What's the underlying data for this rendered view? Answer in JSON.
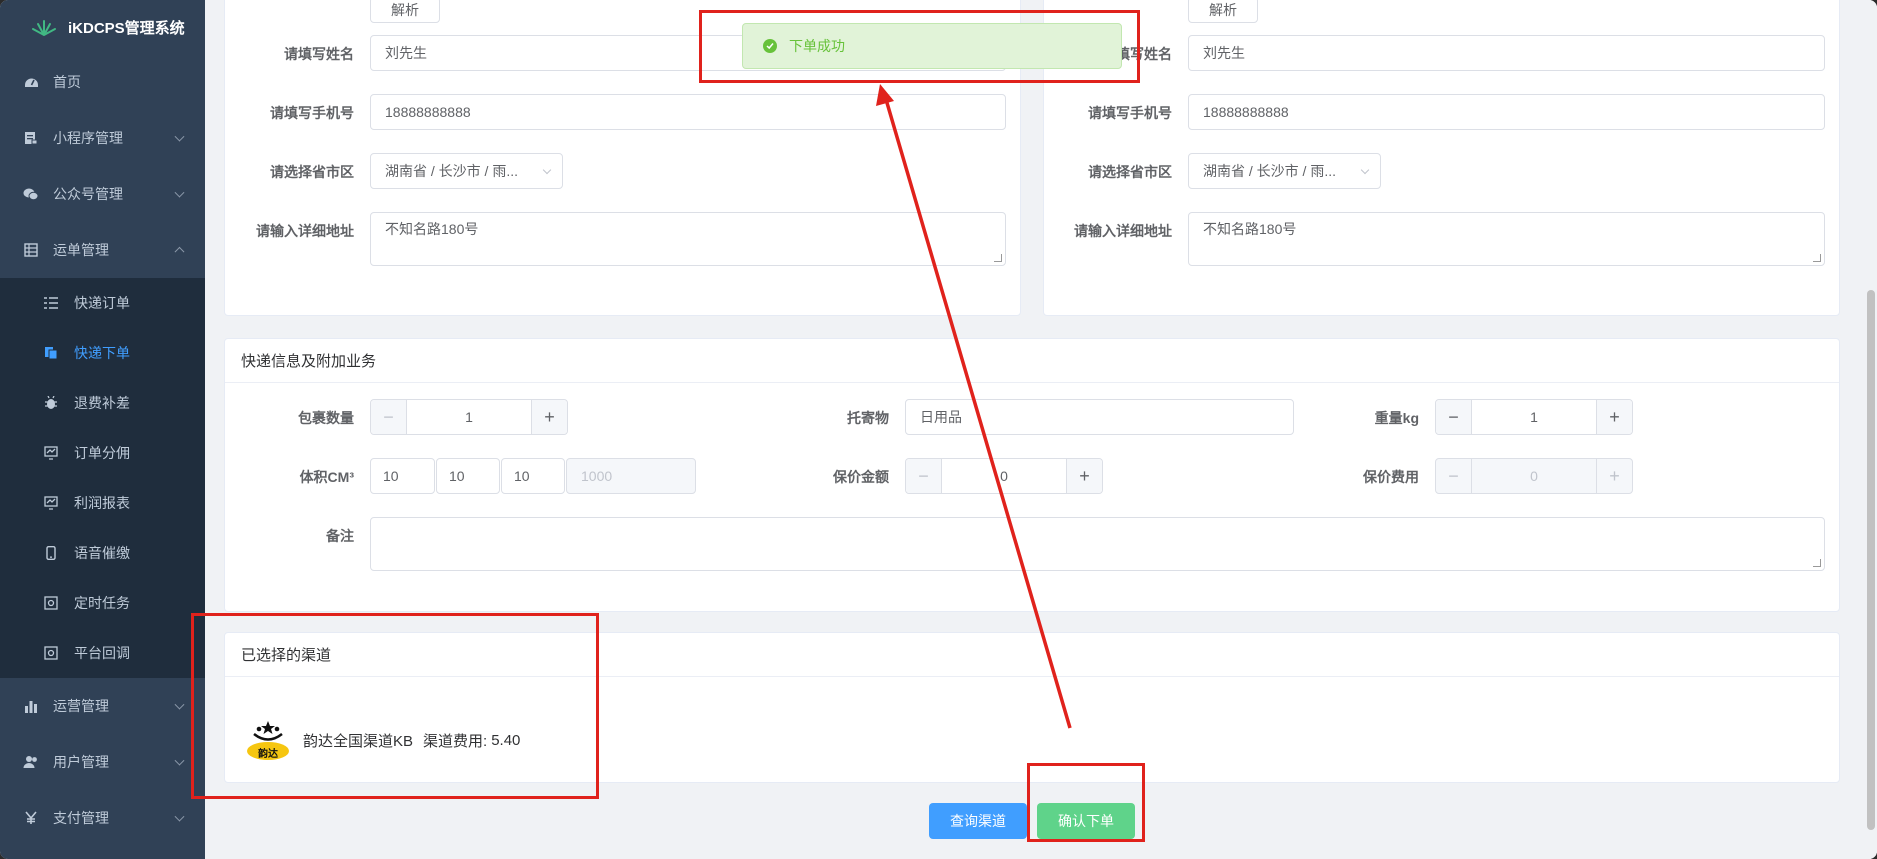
{
  "app_title": "iKDCPS管理系统",
  "sidebar": {
    "items": [
      {
        "label": "首页"
      },
      {
        "label": "小程序管理"
      },
      {
        "label": "公众号管理"
      },
      {
        "label": "运单管理"
      },
      {
        "label": "运营管理"
      },
      {
        "label": "用户管理"
      },
      {
        "label": "支付管理"
      }
    ],
    "sub_items": [
      {
        "label": "快递订单"
      },
      {
        "label": "快递下单"
      },
      {
        "label": "退费补差"
      },
      {
        "label": "订单分佣"
      },
      {
        "label": "利润报表"
      },
      {
        "label": "语音催缴"
      },
      {
        "label": "定时任务"
      },
      {
        "label": "平台回调"
      }
    ]
  },
  "sender": {
    "parse_button": "解析",
    "name_label": "请填写姓名",
    "name_value": "刘先生",
    "phone_label": "请填写手机号",
    "phone_value": "18888888888",
    "region_label": "请选择省市区",
    "region_value": "湖南省 / 长沙市 / 雨...",
    "address_label": "请输入详细地址",
    "address_value": "不知名路180号"
  },
  "receiver": {
    "parse_button": "解析",
    "name_label": "填写姓名",
    "name_value": "刘先生",
    "phone_label": "请填写手机号",
    "phone_value": "18888888888",
    "region_label": "请选择省市区",
    "region_value": "湖南省 / 长沙市 / 雨...",
    "address_label": "请输入详细地址",
    "address_value": "不知名路180号"
  },
  "express": {
    "title": "快递信息及附加业务",
    "package_count_label": "包裹数量",
    "package_count": "1",
    "goods_label": "托寄物",
    "goods_value": "日用品",
    "weight_label": "重量kg",
    "weight_value": "1",
    "volume_label": "体积CM³",
    "volume_l": "10",
    "volume_w": "10",
    "volume_h": "10",
    "volume_total": "1000",
    "insured_label": "保价金额",
    "insured_value": "0",
    "insured_fee_label": "保价费用",
    "insured_fee_value": "0",
    "remark_label": "备注"
  },
  "channel": {
    "title": "已选择的渠道",
    "logo_text": "韵达",
    "name": "韵达全国渠道KB",
    "fee_label": "渠道费用:",
    "fee_value": "5.40"
  },
  "actions": {
    "query_label": "查询渠道",
    "confirm_label": "确认下单"
  },
  "toast": {
    "message": "下单成功"
  },
  "colors": {
    "sidebar_bg": "#304156",
    "active": "#409eff",
    "success": "#67c23a",
    "confirm_btn": "#5fd38a",
    "annotation": "#e0221c"
  }
}
